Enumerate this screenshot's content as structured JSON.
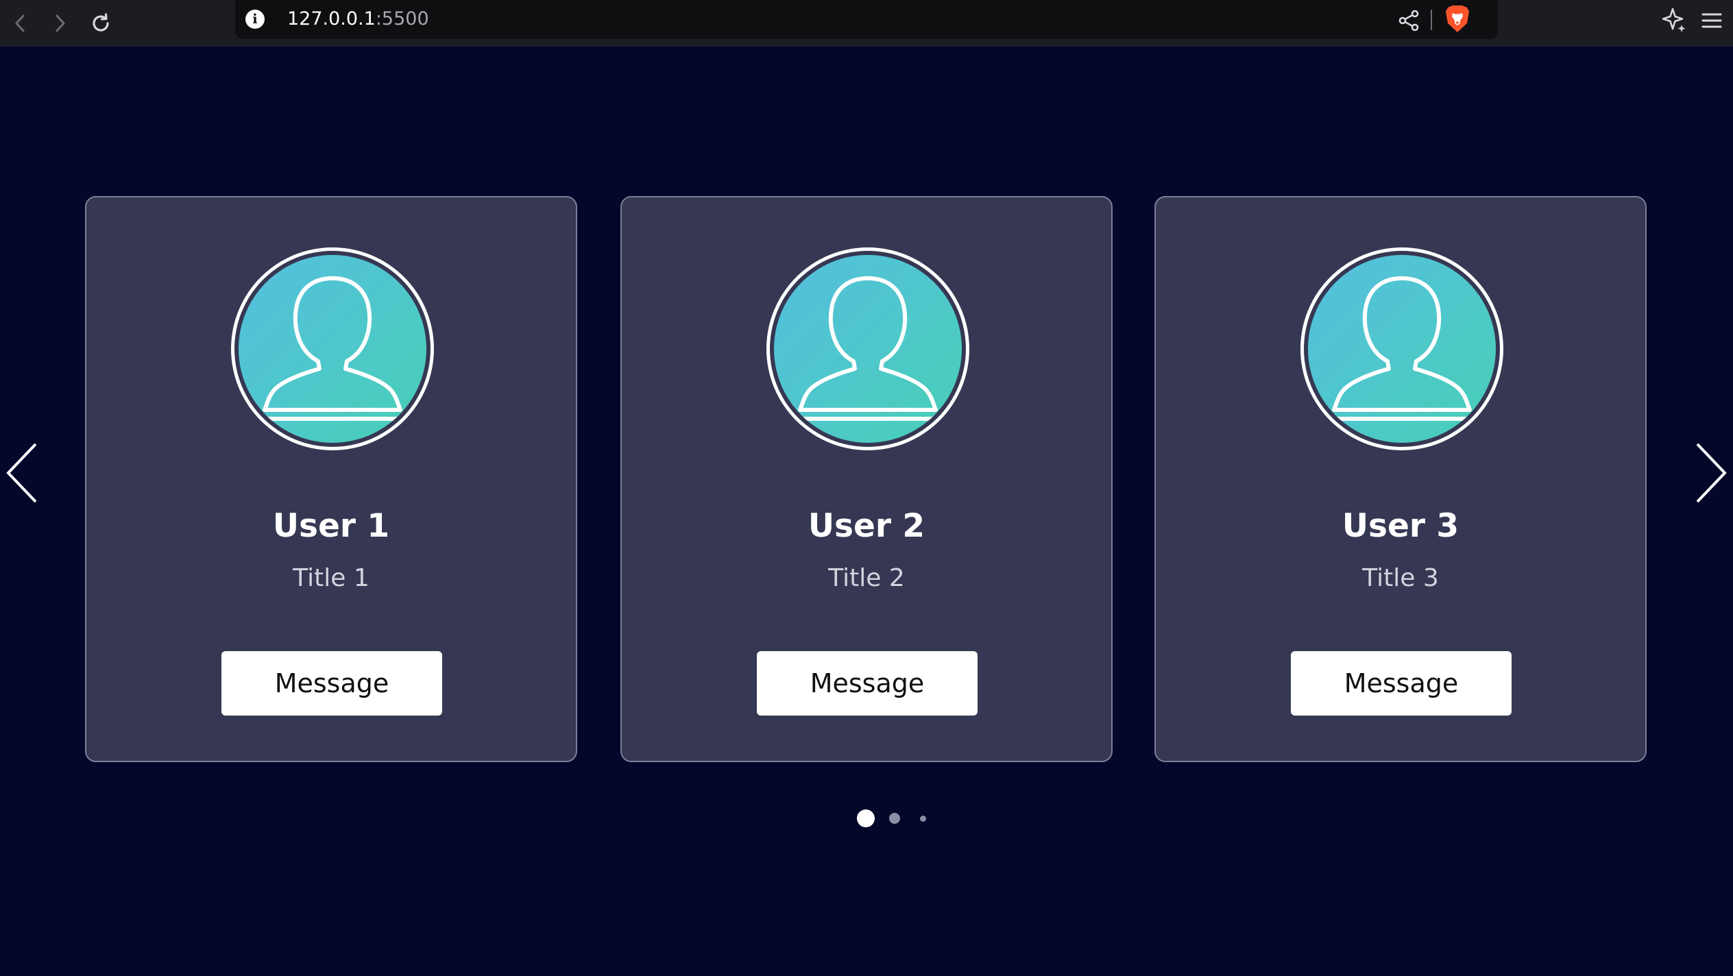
{
  "browser": {
    "url_host": "127.0.0.1",
    "url_port": ":5500",
    "icons": [
      "back-icon",
      "forward-icon",
      "reload-icon",
      "info-icon",
      "share-icon",
      "brave-lion-icon",
      "leo-ai-icon",
      "hamburger-menu-icon"
    ]
  },
  "slider": {
    "cards": [
      {
        "name": "User 1",
        "title": "Title 1",
        "button_label": "Message"
      },
      {
        "name": "User 2",
        "title": "Title 2",
        "button_label": "Message"
      },
      {
        "name": "User 3",
        "title": "Title 3",
        "button_label": "Message"
      }
    ],
    "pagination_count": 3,
    "active_page": 1
  },
  "colors": {
    "page_bg": "#03072a",
    "card_bg": "#363853",
    "avatar_gradient_start": "#55bfe0",
    "avatar_gradient_end": "#48cfb6",
    "brave_orange": "#fb542b"
  }
}
